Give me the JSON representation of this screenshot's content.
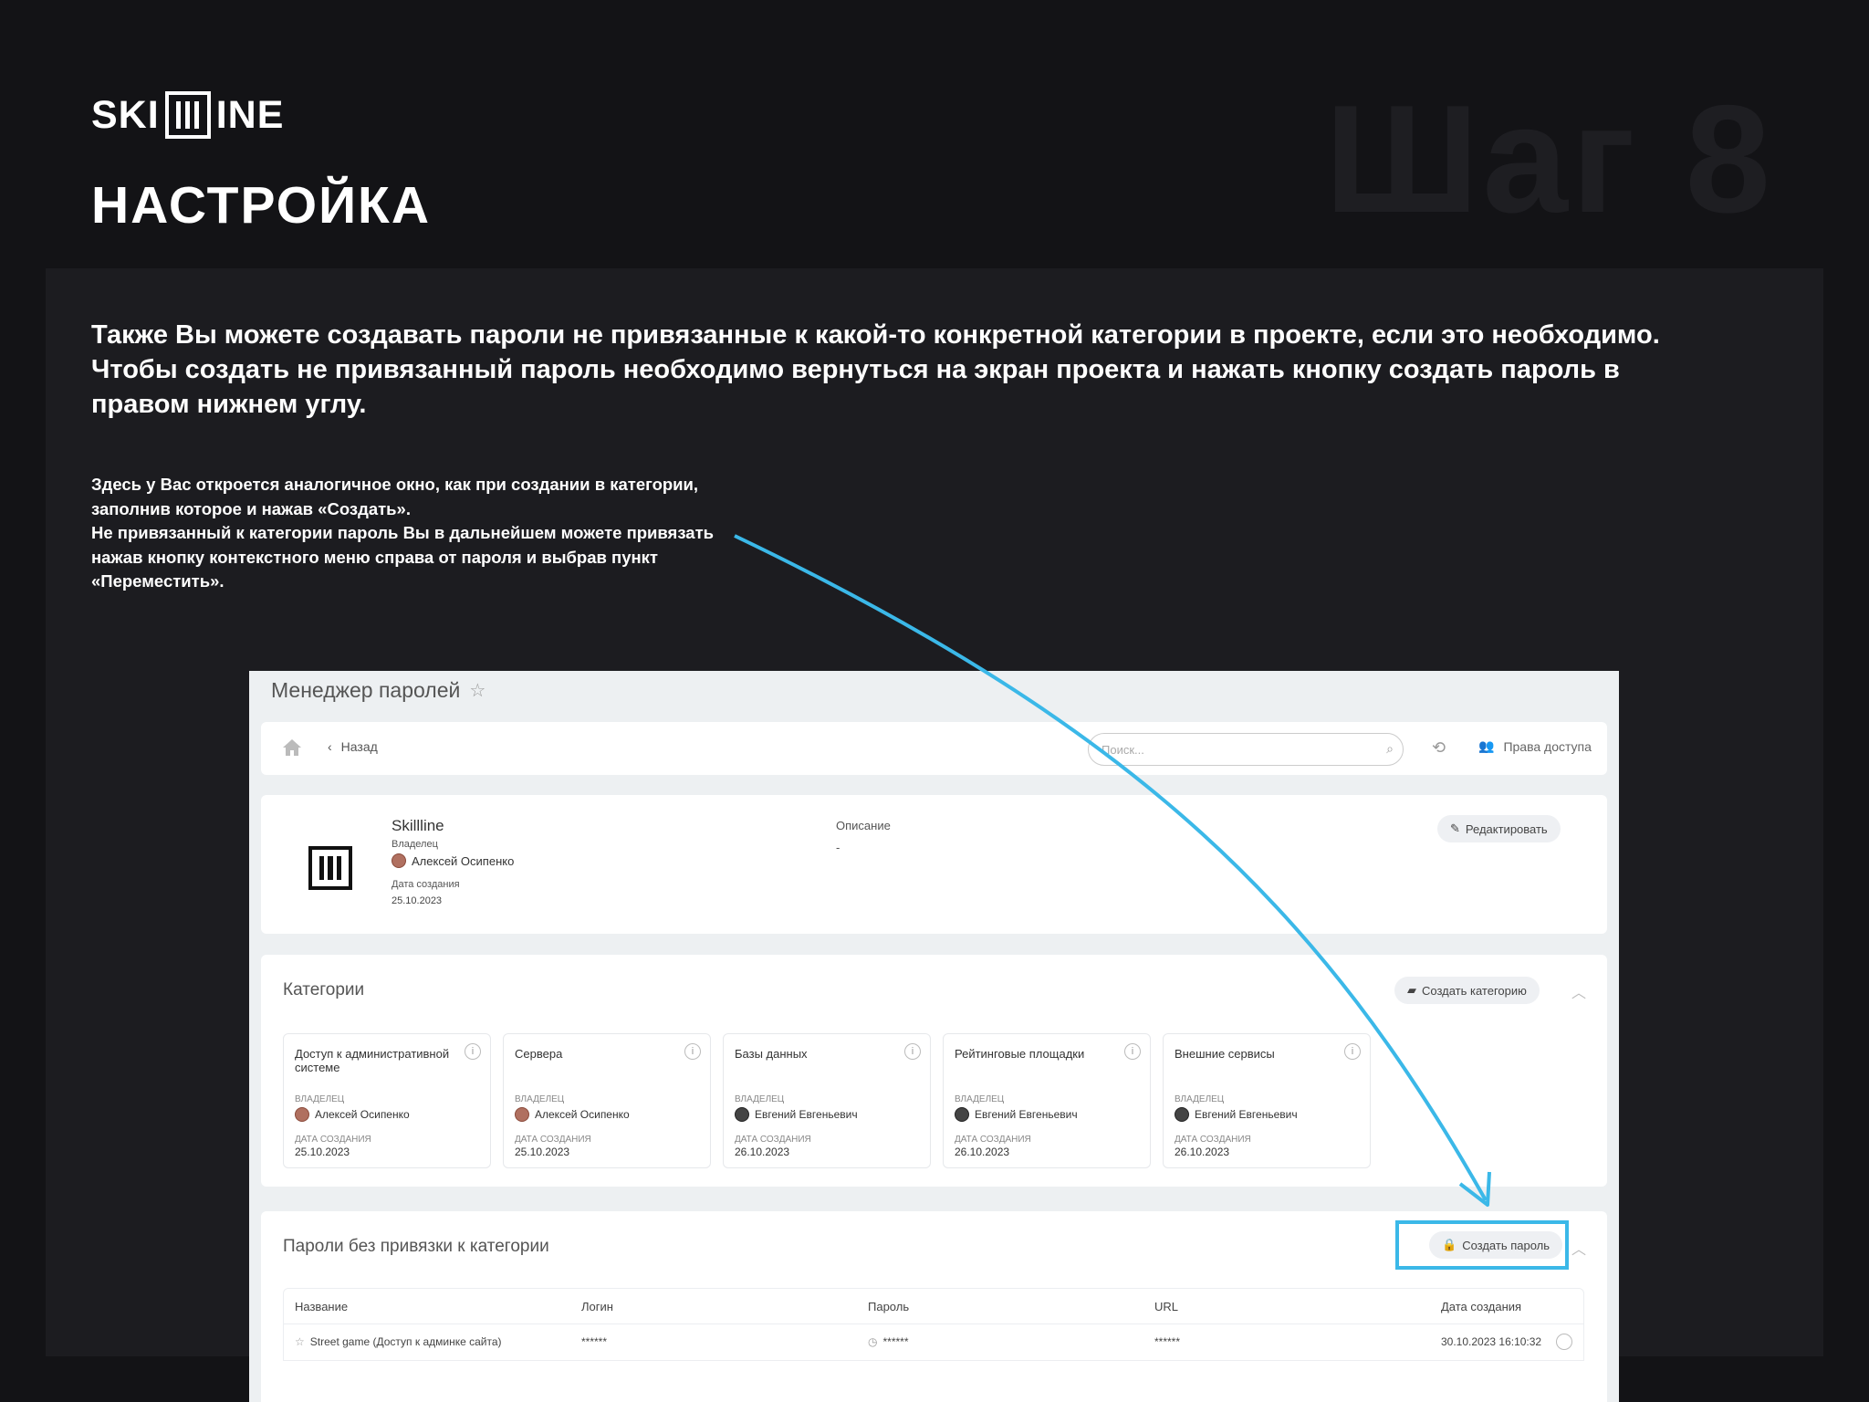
{
  "brand": {
    "logo_left": "SKI",
    "logo_right": "INE"
  },
  "header": {
    "title": "НАСТРОЙКА",
    "step": "Шаг 8"
  },
  "lead": "Также Вы можете создавать пароли не привязанные к какой-то конкретной категории в проекте, если это необходимо. Чтобы создать не привязанный пароль необходимо вернуться на экран проекта и нажать кнопку создать пароль в правом нижнем углу.",
  "note": {
    "line1": "Здесь у Вас откроется аналогичное окно, как при создании в категории, заполнив которое и нажав «Создать».",
    "line2": "Не привязанный к категории пароль Вы в дальнейшем можете привязать нажав кнопку контекстного меню справа от пароля и выбрав пункт «Переместить»."
  },
  "app": {
    "title": "Менеджер паролей",
    "toolbar": {
      "back": "Назад",
      "search_placeholder": "Поиск...",
      "rights": "Права доступа"
    },
    "project": {
      "name": "Skillline",
      "owner_label": "Владелец",
      "owner": "Алексей Осипенко",
      "date_label": "Дата создания",
      "date": "25.10.2023",
      "desc_label": "Описание",
      "desc": "-",
      "edit": "Редактировать"
    },
    "categories": {
      "title": "Категории",
      "create": "Создать категорию",
      "owner_label": "ВЛАДЕЛЕЦ",
      "date_label": "ДАТА СОЗДАНИЯ",
      "items": [
        {
          "name": "Доступ к административной системе",
          "owner": "Алексей Осипенко",
          "date": "25.10.2023"
        },
        {
          "name": "Сервера",
          "owner": "Алексей Осипенко",
          "date": "25.10.2023"
        },
        {
          "name": "Базы данных",
          "owner": "Евгений Евгеньевич",
          "date": "26.10.2023"
        },
        {
          "name": "Рейтинговые площадки",
          "owner": "Евгений Евгеньевич",
          "date": "26.10.2023"
        },
        {
          "name": "Внешние сервисы",
          "owner": "Евгений Евгеньевич",
          "date": "26.10.2023"
        }
      ]
    },
    "passwords": {
      "title": "Пароли без привязки к категории",
      "create": "Создать пароль",
      "columns": [
        "Название",
        "Логин",
        "Пароль",
        "URL",
        "Дата создания"
      ],
      "rows": [
        {
          "name": "Street game (Доступ к админке сайта)",
          "login": "******",
          "password": "******",
          "url": "******",
          "date": "30.10.2023 16:10:32"
        }
      ]
    }
  },
  "colors": {
    "accent": "#3bb8e8",
    "background": "#131316",
    "panel": "#1c1c20"
  }
}
